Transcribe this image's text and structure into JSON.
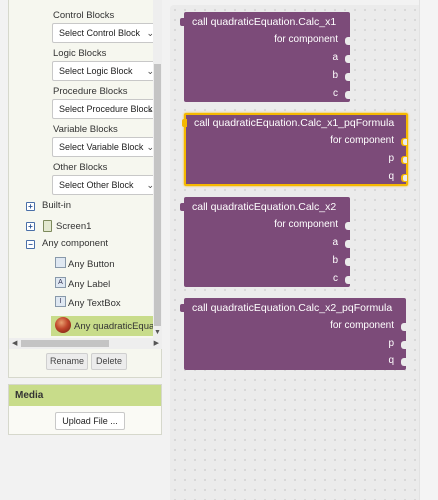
{
  "blocks_panel": {
    "groups": [
      {
        "label": "Control Blocks",
        "select": "Select Control Block"
      },
      {
        "label": "Logic Blocks",
        "select": "Select Logic Block"
      },
      {
        "label": "Procedure Blocks",
        "select": "Select Procedure Block"
      },
      {
        "label": "Variable Blocks",
        "select": "Select Variable Block"
      },
      {
        "label": "Other Blocks",
        "select": "Select Other Block"
      }
    ],
    "tree": {
      "builtin": "Built-in",
      "screen1": "Screen1",
      "any_component": "Any component",
      "items": [
        "Any Button",
        "Any Label",
        "Any TextBox",
        "Any quadraticEquation"
      ]
    },
    "rename_label": "Rename",
    "delete_label": "Delete"
  },
  "media": {
    "title": "Media",
    "upload_label": "Upload File ..."
  },
  "workspace": {
    "blocks": [
      {
        "title": "call quadraticEquation.Calc_x1",
        "component_label": "for component",
        "params": [
          "a",
          "b",
          "c"
        ],
        "selected": false
      },
      {
        "title": "call quadraticEquation.Calc_x1_pqFormula",
        "component_label": "for component",
        "params": [
          "p",
          "q"
        ],
        "selected": true
      },
      {
        "title": "call quadraticEquation.Calc_x2",
        "component_label": "for component",
        "params": [
          "a",
          "b",
          "c"
        ],
        "selected": false
      },
      {
        "title": "call quadraticEquation.Calc_x2_pqFormula",
        "component_label": "for component",
        "params": [
          "p",
          "q"
        ],
        "selected": false
      }
    ]
  },
  "colors": {
    "block_purple": "#7c4b79",
    "selection_yellow": "#f5b800",
    "panel_green": "#c8dc8a"
  }
}
